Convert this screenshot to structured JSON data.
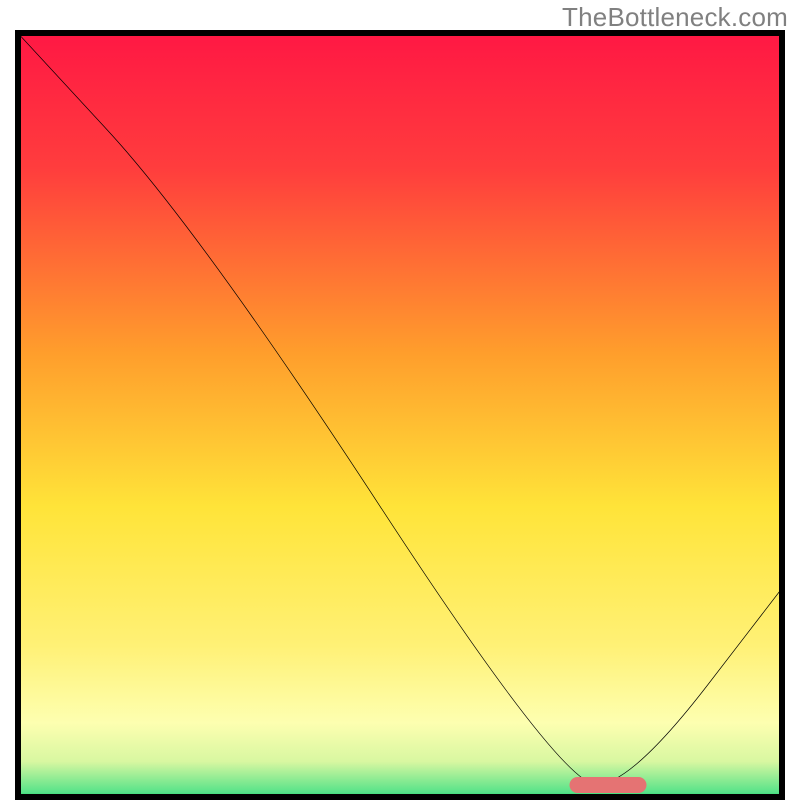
{
  "watermark": "TheBottleneck.com",
  "chart_data": {
    "type": "line",
    "title": "",
    "xlabel": "",
    "ylabel": "",
    "xlim": [
      0,
      100
    ],
    "ylim": [
      0,
      100
    ],
    "gradient_stops": [
      {
        "pct": 0,
        "color": "#ff1744"
      },
      {
        "pct": 18,
        "color": "#ff3d3d"
      },
      {
        "pct": 42,
        "color": "#ff9e2c"
      },
      {
        "pct": 62,
        "color": "#ffe439"
      },
      {
        "pct": 80,
        "color": "#fff176"
      },
      {
        "pct": 90,
        "color": "#fdffb0"
      },
      {
        "pct": 95,
        "color": "#d8f7a1"
      },
      {
        "pct": 99,
        "color": "#57e389"
      },
      {
        "pct": 100,
        "color": "#00c853"
      }
    ],
    "curve_points": [
      {
        "x": 0,
        "y": 100
      },
      {
        "x": 24,
        "y": 74
      },
      {
        "x": 71,
        "y": 2
      },
      {
        "x": 80,
        "y": 2
      },
      {
        "x": 100,
        "y": 28
      }
    ],
    "marker": {
      "x": 77,
      "y": 2,
      "width_pct": 10
    }
  }
}
